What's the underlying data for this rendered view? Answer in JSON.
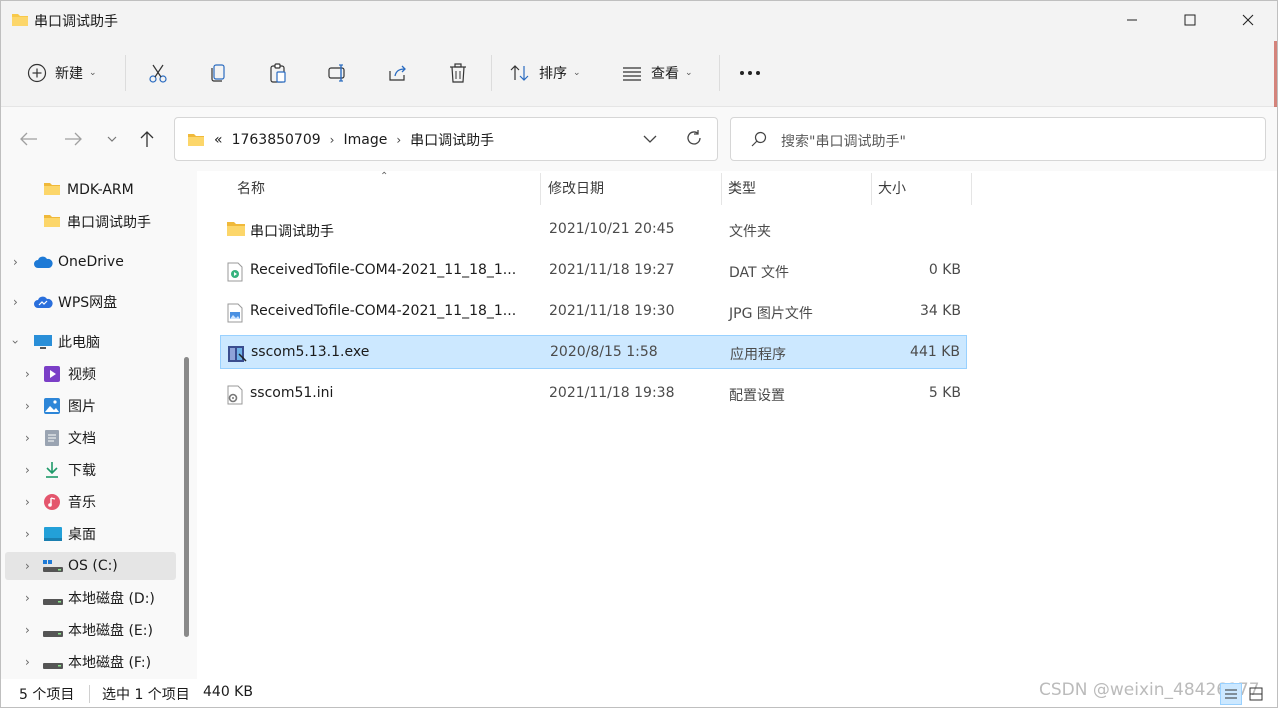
{
  "window": {
    "title": "串口调试助手"
  },
  "toolbar": {
    "new_label": "新建",
    "sort_label": "排序",
    "view_label": "查看"
  },
  "address": {
    "prefix": "«",
    "crumbs": [
      "1763850709",
      "Image",
      "串口调试助手"
    ]
  },
  "search": {
    "placeholder": "搜索\"串口调试助手\""
  },
  "sidebar": {
    "items": [
      {
        "label": "MDK-ARM"
      },
      {
        "label": "串口调试助手"
      },
      {
        "label": "OneDrive"
      },
      {
        "label": "WPS网盘"
      },
      {
        "label": "此电脑"
      },
      {
        "label": "视频"
      },
      {
        "label": "图片"
      },
      {
        "label": "文档"
      },
      {
        "label": "下载"
      },
      {
        "label": "音乐"
      },
      {
        "label": "桌面"
      },
      {
        "label": "OS (C:)"
      },
      {
        "label": "本地磁盘 (D:)"
      },
      {
        "label": "本地磁盘 (E:)"
      },
      {
        "label": "本地磁盘 (F:)"
      }
    ]
  },
  "columns": {
    "name": "名称",
    "date": "修改日期",
    "type": "类型",
    "size": "大小"
  },
  "files": [
    {
      "name": "串口调试助手",
      "date": "2021/10/21 20:45",
      "type": "文件夹",
      "size": ""
    },
    {
      "name": "ReceivedTofile-COM4-2021_11_18_1...",
      "date": "2021/11/18 19:27",
      "type": "DAT 文件",
      "size": "0 KB"
    },
    {
      "name": "ReceivedTofile-COM4-2021_11_18_1...",
      "date": "2021/11/18 19:30",
      "type": "JPG 图片文件",
      "size": "34 KB"
    },
    {
      "name": "sscom5.13.1.exe",
      "date": "2020/8/15 1:58",
      "type": "应用程序",
      "size": "441 KB"
    },
    {
      "name": "sscom51.ini",
      "date": "2021/11/18 19:38",
      "type": "配置设置",
      "size": "5 KB"
    }
  ],
  "status": {
    "count": "5 个项目",
    "selected": "选中 1 个项目",
    "size": "440 KB"
  },
  "watermark": "CSDN @weixin_48426177",
  "colors": {
    "folder": "#f8c94a",
    "selection": "#cce8ff",
    "accent": "#0067c0"
  }
}
